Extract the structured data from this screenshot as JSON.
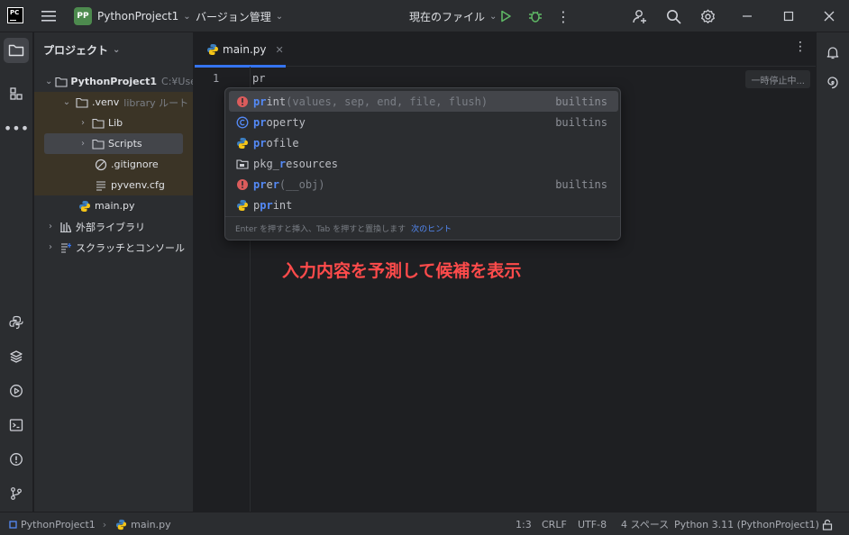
{
  "titlebar": {
    "logo": "PC",
    "project_badge": "PP",
    "project_name": "PythonProject1",
    "vcs_label": "バージョン管理",
    "run_config": "現在のファイル",
    "icons": [
      "hamburger-icon",
      "run-icon",
      "debug-icon",
      "more-vertical-icon",
      "add-user-icon",
      "search-icon",
      "gear-icon",
      "minimize-icon",
      "maximize-icon",
      "close-icon"
    ]
  },
  "project_panel": {
    "title": "プロジェクト",
    "tree": [
      {
        "label": "PythonProject1",
        "extra": "C:¥Users¥",
        "icon": "folder-icon"
      },
      {
        "label": ".venv",
        "extra": "library ルート",
        "icon": "folder-icon"
      },
      {
        "label": "Lib",
        "icon": "folder-icon"
      },
      {
        "label": "Scripts",
        "icon": "folder-icon"
      },
      {
        "label": ".gitignore",
        "icon": "ignore-file-icon"
      },
      {
        "label": "pyvenv.cfg",
        "icon": "text-file-icon"
      },
      {
        "label": "main.py",
        "icon": "python-file-icon"
      },
      {
        "label": "外部ライブラリ",
        "icon": "library-icon"
      },
      {
        "label": "スクラッチとコンソール",
        "icon": "scratch-icon"
      }
    ]
  },
  "editor": {
    "tab_label": "main.py",
    "line_number": "1",
    "code": "pr",
    "paused_label": "一時停止中..."
  },
  "completion": {
    "prefix": "pr",
    "items": [
      {
        "rest": "int",
        "params": "(values, sep, end, file, flush)",
        "tail": "builtins",
        "icon": "error-function-icon"
      },
      {
        "rest": "operty",
        "params": "",
        "tail": "builtins",
        "icon": "class-icon"
      },
      {
        "rest": "ofile",
        "params": "",
        "tail": "",
        "icon": "python-module-icon"
      },
      {
        "pre": "pkg_",
        "match": "r",
        "rest": "esources",
        "params": "",
        "tail": "",
        "icon": "package-icon"
      },
      {
        "pre": "",
        "match": "r",
        "rest": "",
        "params": "(__obj)",
        "tail": "builtins",
        "icon": "error-function-icon"
      },
      {
        "pre": "p",
        "match": "pr",
        "rest": "int",
        "params": "",
        "tail": "",
        "icon": "python-module-icon"
      }
    ],
    "footer_text": "Enter を押すと挿入、Tab を押すと置換します",
    "footer_link": "次のヒント"
  },
  "annotation": "入力内容を予測して候補を表示",
  "statusbar": {
    "breadcrumb_project": "PythonProject1",
    "breadcrumb_file": "main.py",
    "position": "1:3",
    "line_ending": "CRLF",
    "encoding": "UTF-8",
    "indent": "4 スペース",
    "interpreter": "Python 3.11 (PythonProject1)"
  },
  "colors": {
    "accent": "#3574f0",
    "match": "#548af7",
    "annotation": "#ff4b4b",
    "badge": "#4d8a4e"
  }
}
